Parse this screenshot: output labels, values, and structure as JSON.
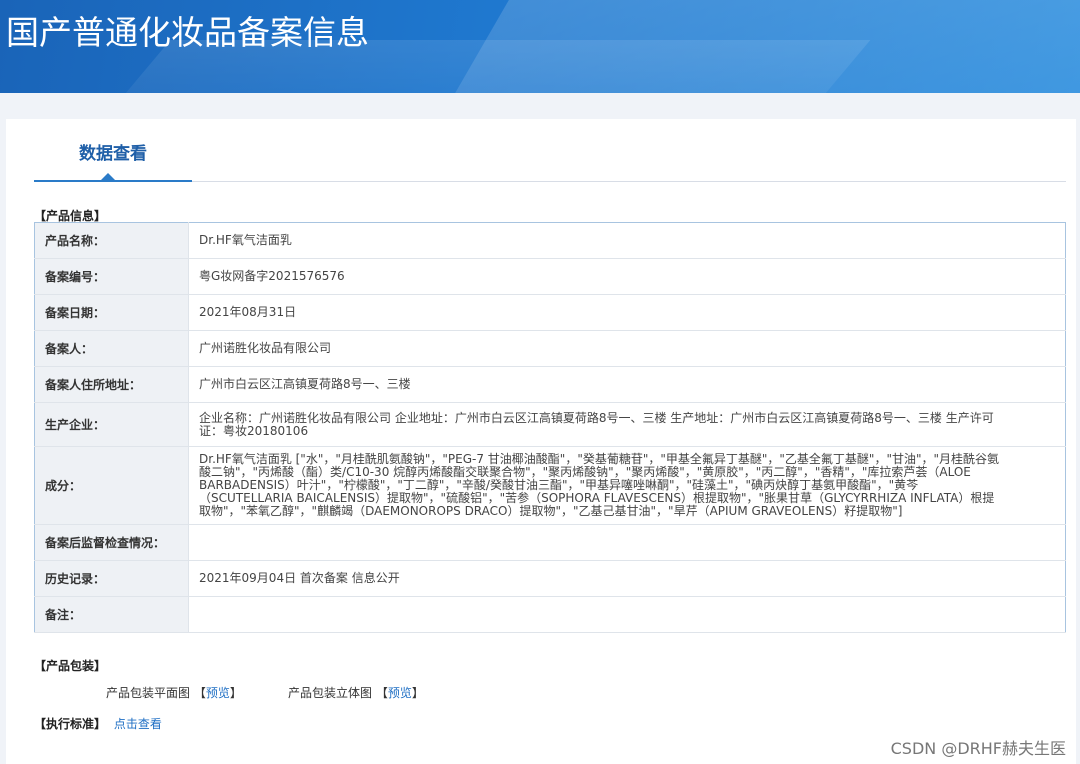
{
  "header": {
    "title": "国产普通化妆品备案信息"
  },
  "tabs": {
    "active": "数据查看"
  },
  "product_info": {
    "section_title": "【产品信息】",
    "rows": [
      {
        "label": "产品名称：",
        "value": "Dr.HF氧气洁面乳"
      },
      {
        "label": "备案编号：",
        "value": "粤G妆网备字2021576576"
      },
      {
        "label": "备案日期：",
        "value": "2021年08月31日"
      },
      {
        "label": "备案人：",
        "value": "广州诺胜化妆品有限公司"
      },
      {
        "label": "备案人住所地址：",
        "value": "广州市白云区江高镇夏荷路8号一、三楼"
      },
      {
        "label": "生产企业：",
        "value": "企业名称：广州诺胜化妆品有限公司 企业地址：广州市白云区江高镇夏荷路8号一、三楼 生产地址：广州市白云区江高镇夏荷路8号一、三楼 生产许可证：粤妆20180106"
      },
      {
        "label": "成分：",
        "value": "Dr.HF氧气洁面乳 [\"水\"，\"月桂酰肌氨酸钠\"，\"PEG-7 甘油椰油酸酯\"，\"癸基葡糖苷\"，\"甲基全氟异丁基醚\"，\"乙基全氟丁基醚\"，\"甘油\"，\"月桂酰谷氨酸二钠\"，\"丙烯酸（酯）类/C10-30 烷醇丙烯酸酯交联聚合物\"，\"聚丙烯酸钠\"，\"聚丙烯酸\"，\"黄原胶\"，\"丙二醇\"，\"香精\"，\"库拉索芦荟（ALOE BARBADENSIS）叶汁\"，\"柠檬酸\"，\"丁二醇\"，\"辛酸/癸酸甘油三酯\"，\"甲基异噻唑啉酮\"，\"硅藻土\"，\"碘丙炔醇丁基氨甲酸酯\"，\"黄芩（SCUTELLARIA BAICALENSIS）提取物\"，\"硫酸铝\"，\"苦参（SOPHORA FLAVESCENS）根提取物\"，\"胀果甘草（GLYCYRRHIZA INFLATA）根提取物\"，\"苯氧乙醇\"，\"麒麟竭（DAEMONOROPS DRACO）提取物\"，\"乙基己基甘油\"，\"旱芹（APIUM GRAVEOLENS）籽提取物\"]"
      },
      {
        "label": "备案后监督检查情况：",
        "value": ""
      },
      {
        "label": "历史记录：",
        "value": "2021年09月04日 首次备案 信息公开"
      },
      {
        "label": "备注：",
        "value": ""
      }
    ]
  },
  "packaging": {
    "section_title": "【产品包装】",
    "flat_label": "产品包装平面图",
    "solid_label": "产品包装立体图",
    "preview_link": "预览",
    "bracket_open": "【",
    "bracket_close": "】"
  },
  "standard": {
    "section_title": "【执行标准】",
    "link": "点击查看"
  },
  "watermark": "CSDN @DRHF赫夫生医"
}
